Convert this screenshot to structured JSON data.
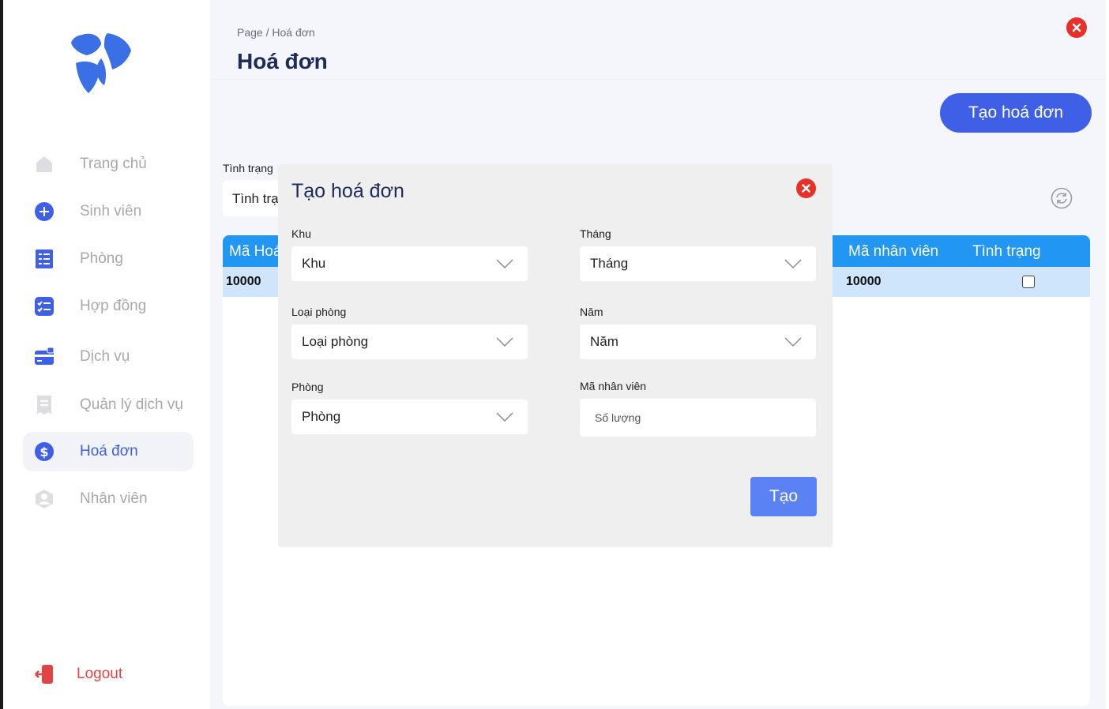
{
  "sidebar": {
    "items": [
      {
        "label": "Trang chủ",
        "icon": "home-icon",
        "active": false
      },
      {
        "label": "Sinh viên",
        "icon": "plus-circle-icon",
        "active": false
      },
      {
        "label": "Phòng",
        "icon": "room-list-icon",
        "active": false
      },
      {
        "label": "Hợp đồng",
        "icon": "checklist-icon",
        "active": false
      },
      {
        "label": "Dịch vụ",
        "icon": "card-icon",
        "active": false
      },
      {
        "label": "Quản lý dịch vụ",
        "icon": "receipt-icon",
        "active": false
      },
      {
        "label": "Hoá đơn",
        "icon": "dollar-icon",
        "active": true
      },
      {
        "label": "Nhân viên",
        "icon": "user-icon",
        "active": false
      }
    ],
    "logout_label": "Logout"
  },
  "header": {
    "breadcrumb": "Page / Hoá đơn",
    "title": "Hoá đơn"
  },
  "toolbar": {
    "create_label": "Tạo hoá đơn"
  },
  "filters": {
    "status_label": "Tình trạng",
    "status_value": "Tình trạ"
  },
  "table": {
    "columns": [
      "Mã Hoá",
      "Mã nhân viên",
      "Tình trạng"
    ],
    "rows": [
      {
        "ma_hoa_don": "10000",
        "ma_nhan_vien": "10000",
        "tinh_trang": false
      }
    ]
  },
  "modal": {
    "title": "Tạo hoá đơn",
    "fields": {
      "khu": {
        "label": "Khu",
        "value": "Khu"
      },
      "thang": {
        "label": "Tháng",
        "value": "Tháng"
      },
      "loai_phong": {
        "label": "Loại phòng",
        "value": "Loại phòng"
      },
      "nam": {
        "label": "Năm",
        "value": "Năm"
      },
      "phong": {
        "label": "Phòng",
        "value": "Phòng"
      },
      "ma_nhan_vien": {
        "label": "Mã nhân viên",
        "placeholder": "Số lượng"
      }
    },
    "submit_label": "Tạo"
  },
  "colors": {
    "accent": "#3f5fe6",
    "table_header": "#2196f3",
    "row_highlight": "#cfe5fb",
    "danger": "#e8302b",
    "submit": "#5b82f5"
  }
}
